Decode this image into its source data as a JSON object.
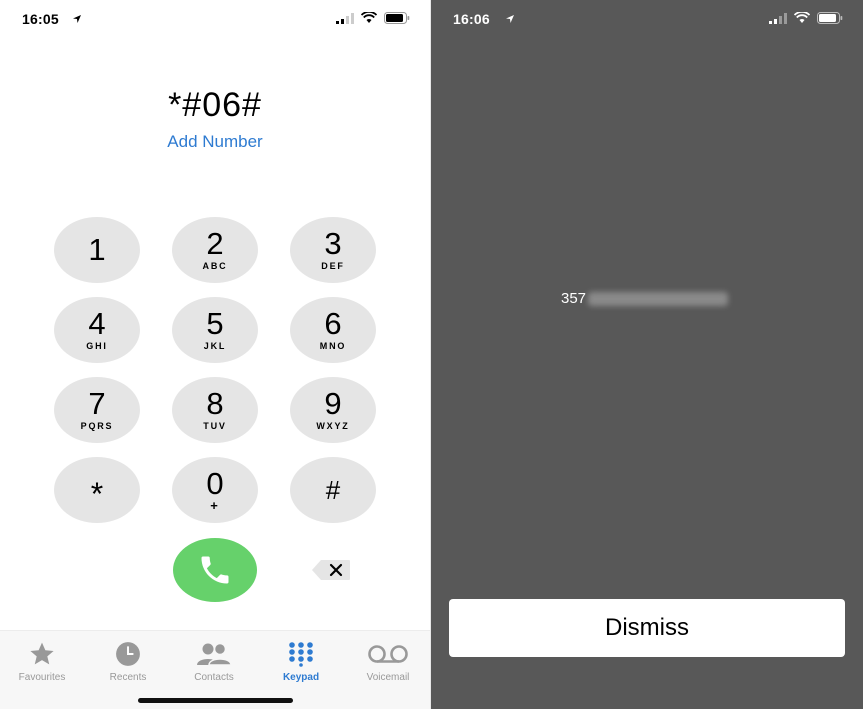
{
  "left_screen": {
    "status": {
      "time": "16:05"
    },
    "dialed_number": "*#06#",
    "add_number_label": "Add Number",
    "keys": [
      {
        "digit": "1",
        "letters": ""
      },
      {
        "digit": "2",
        "letters": "ABC"
      },
      {
        "digit": "3",
        "letters": "DEF"
      },
      {
        "digit": "4",
        "letters": "GHI"
      },
      {
        "digit": "5",
        "letters": "JKL"
      },
      {
        "digit": "6",
        "letters": "MNO"
      },
      {
        "digit": "7",
        "letters": "PQRS"
      },
      {
        "digit": "8",
        "letters": "TUV"
      },
      {
        "digit": "9",
        "letters": "WXYZ"
      },
      {
        "digit": "*",
        "letters": ""
      },
      {
        "digit": "0",
        "letters": "+"
      },
      {
        "digit": "#",
        "letters": ""
      }
    ],
    "tabs": [
      {
        "label": "Favourites",
        "icon": "star-icon"
      },
      {
        "label": "Recents",
        "icon": "clock-icon"
      },
      {
        "label": "Contacts",
        "icon": "contacts-icon"
      },
      {
        "label": "Keypad",
        "icon": "keypad-icon",
        "active": true
      },
      {
        "label": "Voicemail",
        "icon": "voicemail-icon"
      }
    ],
    "colors": {
      "accent": "#2e7bd1",
      "call": "#66d16b",
      "key": "#e5e5e5"
    }
  },
  "right_screen": {
    "status": {
      "time": "16:06"
    },
    "imei_prefix": "357",
    "dismiss_label": "Dismiss",
    "colors": {
      "background": "#585858"
    }
  }
}
